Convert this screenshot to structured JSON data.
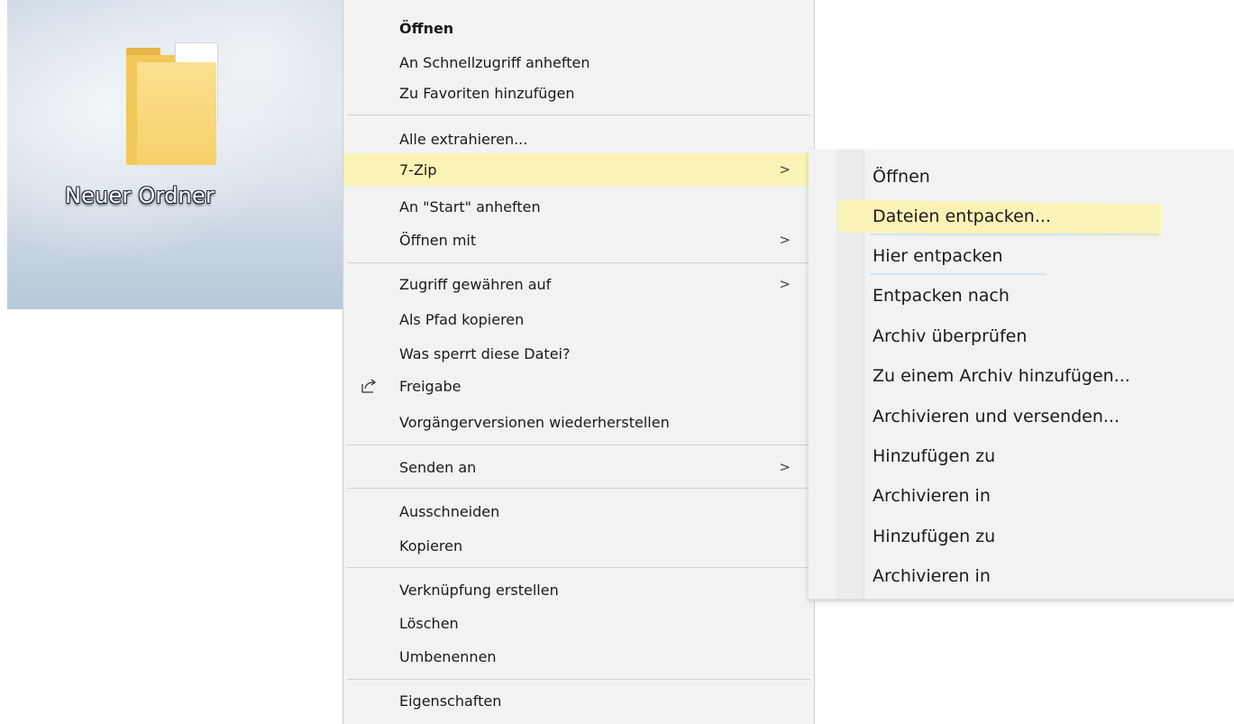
{
  "desktop": {
    "folder_name": "Neuer Ordner"
  },
  "context_menu": {
    "items": [
      {
        "label": "Öffnen",
        "bold": true
      },
      {
        "label": "An Schnellzugriff anheften"
      },
      {
        "label": "Zu Favoriten hinzufügen"
      },
      {
        "label": "Alle extrahieren..."
      },
      {
        "label": "7-Zip",
        "submenu_arrow": ">",
        "highlighted": true
      },
      {
        "label": "An \"Start\" anheften"
      },
      {
        "label": "Öffnen mit",
        "submenu_arrow": ">"
      },
      {
        "label": "Zugriff gewähren auf",
        "submenu_arrow": ">"
      },
      {
        "label": "Als Pfad kopieren"
      },
      {
        "label": "Was sperrt diese Datei?"
      },
      {
        "label": "Freigabe",
        "icon": "share-icon"
      },
      {
        "label": "Vorgängerversionen wiederherstellen"
      },
      {
        "label": "Senden an",
        "submenu_arrow": ">"
      },
      {
        "label": "Ausschneiden"
      },
      {
        "label": "Kopieren"
      },
      {
        "label": "Verknüpfung erstellen"
      },
      {
        "label": "Löschen"
      },
      {
        "label": "Umbenennen"
      },
      {
        "label": "Eigenschaften"
      }
    ]
  },
  "submenu_7zip": {
    "items": [
      {
        "label": "Öffnen"
      },
      {
        "label": "Dateien entpacken...",
        "highlighted": true
      },
      {
        "label": "Hier entpacken"
      },
      {
        "label": "Entpacken nach"
      },
      {
        "label": "Archiv überprüfen"
      },
      {
        "label": "Zu einem Archiv hinzufügen..."
      },
      {
        "label": "Archivieren und versenden..."
      },
      {
        "label": "Hinzufügen zu"
      },
      {
        "label": "Archivieren in"
      },
      {
        "label": "Hinzufügen zu"
      },
      {
        "label": "Archivieren in"
      }
    ]
  },
  "colors": {
    "menu_background": "#f2f2f2",
    "highlight": "#fbf3b6",
    "separator": "#cfcfcf",
    "folder_yellow": "#f6d06c"
  }
}
